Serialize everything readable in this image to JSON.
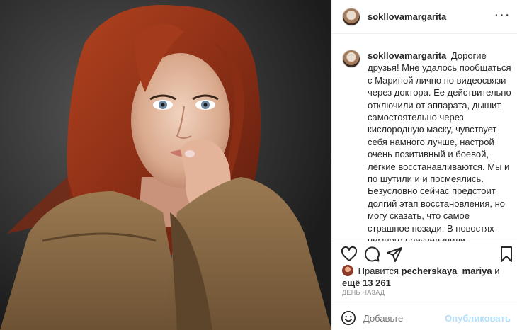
{
  "post": {
    "username": "sokllovamargarita",
    "caption": "Дорогие друзья! Мне удалось пообщаться с Мариной лично по видеосвязи через доктора. Ее действительно отключили от аппарата, дышит самостоятельно через кислородную маску, чувствует себя намного лучше, настрой очень позитивный и боевой, лёгкие восстанавливаются. Мы и по шутили и и посмеялись. Безусловно сейчас предстоит долгий этап восстановления, но могу сказать, что самое страшное позади. В новостях немного преувеличили - телевизора в реанимации нет и врачи не возят ее по реанимации - во-первых это запрещено, во-вторых врачи заняты своим делом, а не катанием пациентов по больнице ))) Передаю",
    "more_glyph": "···"
  },
  "likes": {
    "prefix": "Нравится",
    "user": "pecherskaya_mariya",
    "and": "и",
    "count_text": "ещё 13 261"
  },
  "time": "ДЕНЬ НАЗАД",
  "comment": {
    "placeholder": "Добавьте",
    "publish_label": "Опубликовать"
  },
  "colors": {
    "accent_disabled": "#b2dffc",
    "muted_text": "#8e8e8e",
    "border": "#efefef"
  },
  "icons": {
    "like": "heart-icon",
    "comment": "comment-icon",
    "share": "paper-plane-icon",
    "save": "bookmark-icon",
    "emoji": "smiley-icon",
    "more": "ellipsis-icon"
  }
}
